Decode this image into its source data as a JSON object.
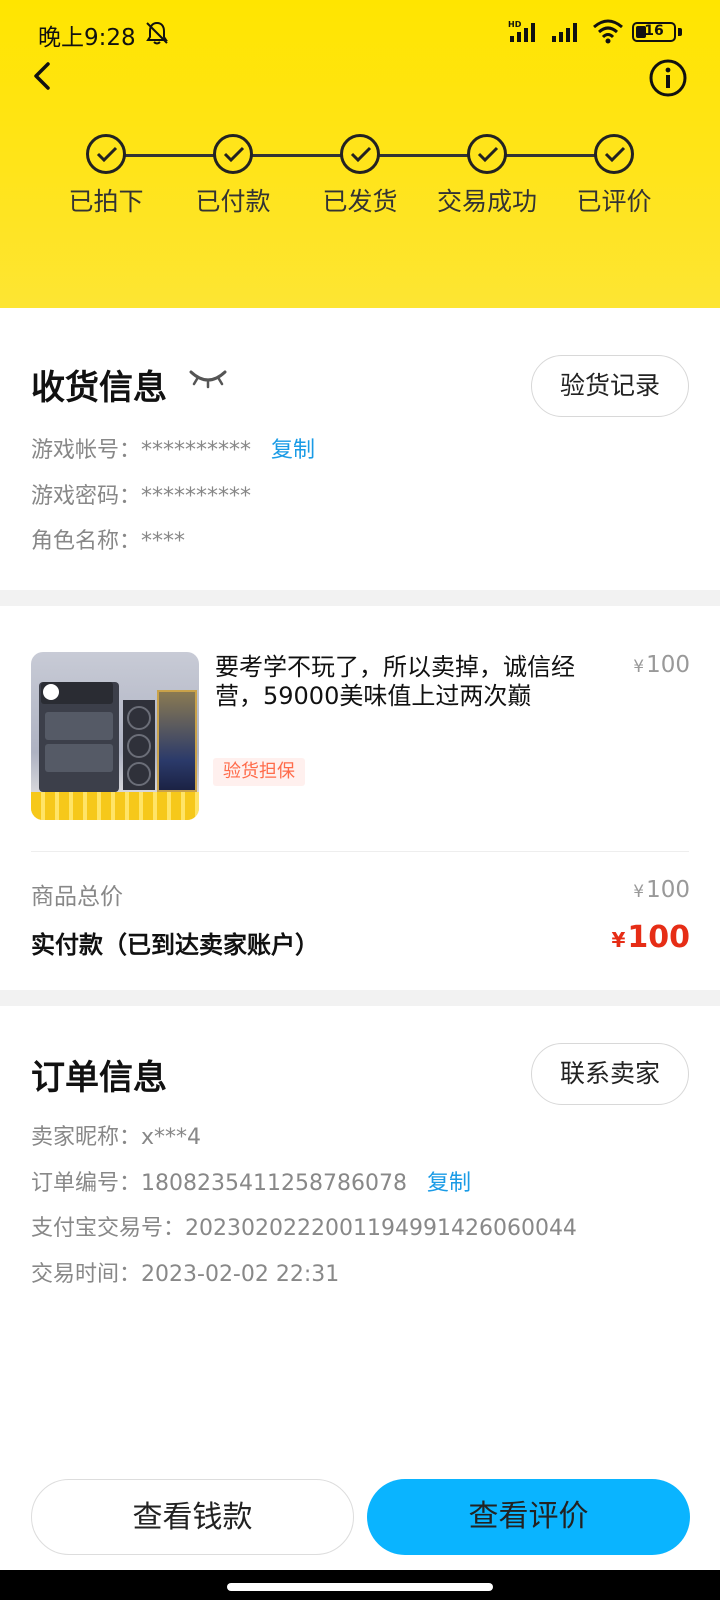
{
  "status_bar": {
    "time": "晚上9:28",
    "battery": "16",
    "icons": [
      "bell-off-icon",
      "hd-signal-icon",
      "signal-icon",
      "wifi-icon",
      "battery-icon"
    ]
  },
  "header": {
    "icons": [
      "back-icon",
      "info-icon"
    ],
    "steps": [
      {
        "label": "已拍下",
        "done": true
      },
      {
        "label": "已付款",
        "done": true
      },
      {
        "label": "已发货",
        "done": true
      },
      {
        "label": "交易成功",
        "done": true
      },
      {
        "label": "已评价",
        "done": true
      }
    ],
    "colors": {
      "background": "#ffe500"
    }
  },
  "delivery": {
    "title": "收货信息",
    "inspect_button": "验货记录",
    "account_label": "游戏帐号：",
    "account_value": "**********",
    "copy_label": "复制",
    "password_label": "游戏密码：",
    "password_value": "**********",
    "role_label": "角色名称：",
    "role_value": "****",
    "eye_icon": "eye-closed-icon"
  },
  "product": {
    "title": "要考学不玩了，所以卖掉，诚信经营，59000美味值上过两次巅",
    "price_symbol": "¥",
    "price": "100",
    "badge": "验货担保",
    "total_label": "商品总价",
    "total_symbol": "¥",
    "total_value": "100",
    "paid_label": "实付款（已到达卖家账户）",
    "paid_symbol": "¥",
    "paid_value": "100",
    "colors": {
      "paid": "#e62d16",
      "badge": "#ff6b4a"
    }
  },
  "order": {
    "title": "订单信息",
    "contact_button": "联系卖家",
    "seller_label": "卖家昵称：",
    "seller_value": "x***4",
    "order_no_label": "订单编号：",
    "order_no_value": "1808235411258786078",
    "copy_label": "复制",
    "alipay_label": "支付宝交易号：",
    "alipay_value": "2023020222001194991426060044",
    "time_label": "交易时间：",
    "time_value": "2023-02-02 22:31"
  },
  "actions": {
    "view_money": "查看钱款",
    "view_review": "查看评价",
    "colors": {
      "primary": "#0ab4ff"
    }
  }
}
